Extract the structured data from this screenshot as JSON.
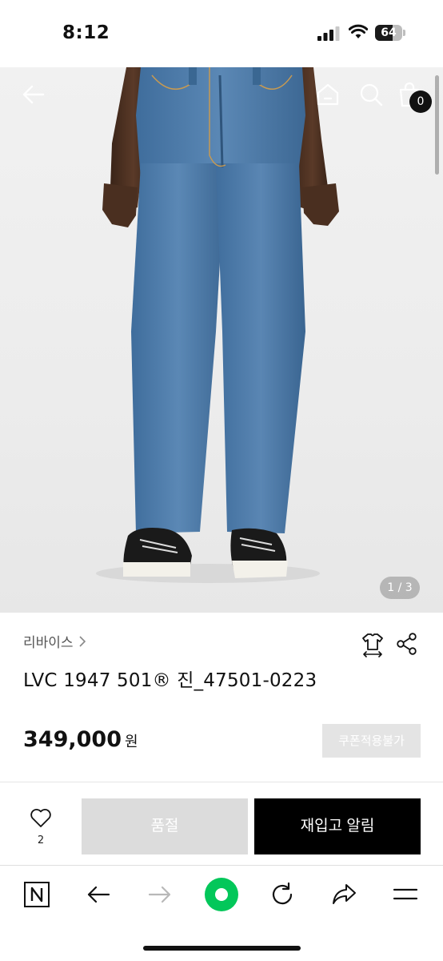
{
  "status_bar": {
    "time": "8:12",
    "battery_percent": "64",
    "battery_level": 0.64
  },
  "hero": {
    "image_description": "",
    "pager": "1 / 3",
    "cart_count": "0"
  },
  "product": {
    "brand": "리바이스",
    "name": "LVC 1947 501® 진_47501-0223",
    "price": "349,000",
    "price_unit": "원",
    "coupon_label": "쿠폰적용불가"
  },
  "actions": {
    "like_count": "2",
    "soldout_label": "품절",
    "restock_label": "재입고 알림"
  },
  "colors": {
    "accent_green": "#03c75a",
    "denim": "#4a78a6"
  }
}
